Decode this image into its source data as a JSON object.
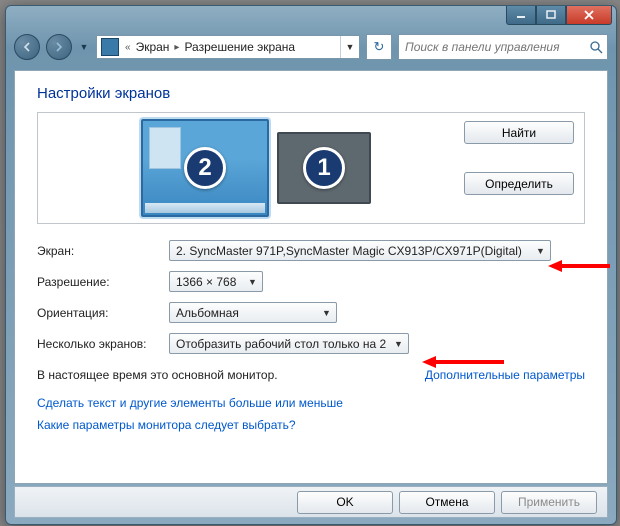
{
  "titlebar": {
    "minimize": "–",
    "maximize": "□",
    "close": "✕"
  },
  "address": {
    "pre_chev": "«",
    "crumb1": "Экран",
    "crumb2": "Разрешение экрана"
  },
  "search": {
    "placeholder": "Поиск в панели управления"
  },
  "heading": "Настройки экранов",
  "monitors": {
    "selected_num": "2",
    "other_num": "1",
    "detect": "Найти",
    "identify": "Определить"
  },
  "fields": {
    "display_label": "Экран:",
    "display_value": "2. SyncMaster 971P,SyncMaster Magic CX913P/CX971P(Digital)",
    "resolution_label": "Разрешение:",
    "resolution_value": "1366 × 768",
    "orientation_label": "Ориентация:",
    "orientation_value": "Альбомная",
    "multi_label": "Несколько экранов:",
    "multi_value": "Отобразить рабочий стол только на 2"
  },
  "status": "В настоящее время это основной монитор.",
  "advanced": "Дополнительные параметры",
  "links": {
    "text_size": "Сделать текст и другие элементы больше или меньше",
    "which_settings": "Какие параметры монитора следует выбрать?"
  },
  "footer": {
    "ok": "OK",
    "cancel": "Отмена",
    "apply": "Применить"
  }
}
